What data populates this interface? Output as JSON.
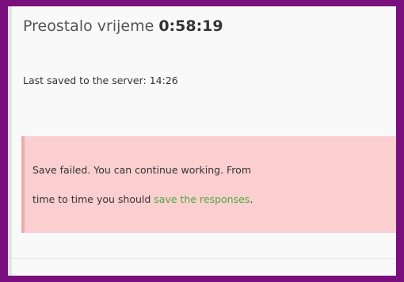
{
  "timer": {
    "label": "Preostalo vrijeme",
    "value": "0:58:19"
  },
  "save_status": {
    "text": "Last saved to the server: 14:26"
  },
  "alert": {
    "line1": "Save failed. You can continue working. From",
    "line2_prefix": "time to time you should",
    "link_text": "save the responses",
    "line2_suffix": ".",
    "background_color": "#fbcfcf",
    "link_color": "#4fa83d"
  },
  "colors": {
    "frame": "#7a0f7e"
  }
}
